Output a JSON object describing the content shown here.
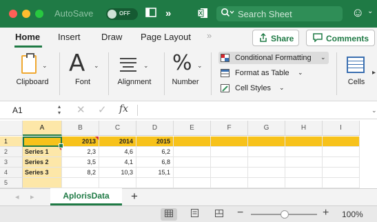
{
  "titlebar": {
    "autosave_label": "AutoSave",
    "autosave_state": "OFF",
    "search_placeholder": "Search Sheet",
    "more_icon": "chevrons-right-icon"
  },
  "tabs": [
    "Home",
    "Insert",
    "Draw",
    "Page Layout"
  ],
  "actions": {
    "share_label": "Share",
    "comments_label": "Comments"
  },
  "ribbon": {
    "clipboard": "Clipboard",
    "font": "Font",
    "font_glyph": "A",
    "alignment": "Alignment",
    "number": "Number",
    "number_glyph": "%",
    "conditional_formatting": "Conditional Formatting",
    "format_as_table": "Format as Table",
    "cell_styles": "Cell Styles",
    "cells": "Cells"
  },
  "formula_bar": {
    "name_box": "A1",
    "fx": "fx",
    "value": ""
  },
  "grid": {
    "columns": [
      "A",
      "B",
      "C",
      "D",
      "E",
      "F",
      "G",
      "H",
      "I"
    ],
    "rows": [
      "1",
      "2",
      "3",
      "4",
      "5"
    ],
    "header_years": [
      "2013",
      "2014",
      "2015"
    ],
    "series": [
      {
        "label": "Series 1",
        "values": [
          "2,3",
          "4,6",
          "6,2"
        ]
      },
      {
        "label": "Series 2",
        "values": [
          "3,5",
          "4,1",
          "6,8"
        ]
      },
      {
        "label": "Series 3",
        "values": [
          "8,2",
          "10,3",
          "15,1"
        ]
      }
    ]
  },
  "sheet_tabs": {
    "active": "AplorisData",
    "add": "+"
  },
  "status": {
    "zoom": "100%",
    "zoom_percent": 100
  },
  "colors": {
    "accent": "#1f7a45",
    "header_row": "#f7c21b",
    "first_column": "#fde7a8"
  }
}
